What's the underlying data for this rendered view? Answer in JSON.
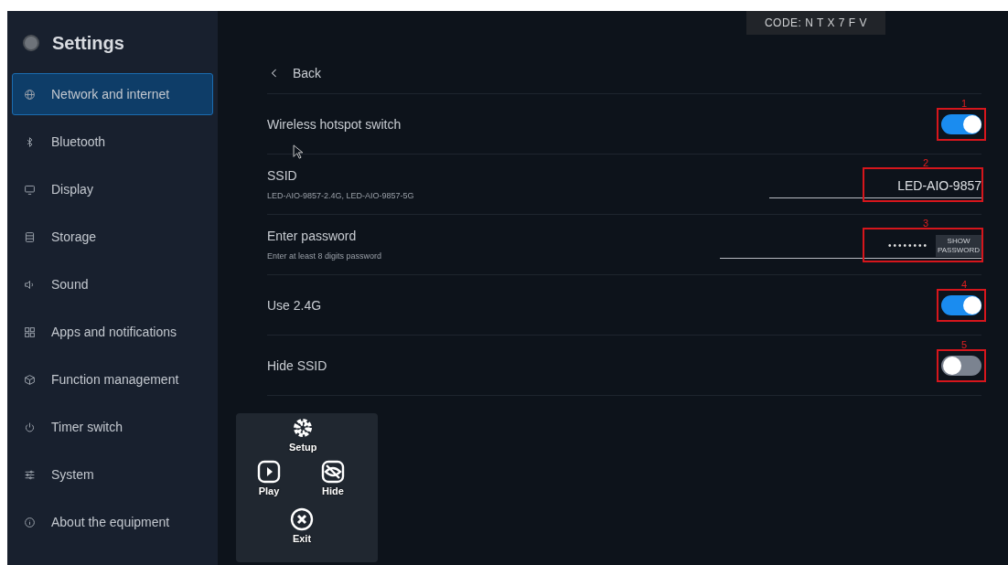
{
  "code_badge": {
    "text": "CODE:  N T X 7 F V"
  },
  "sidebar": {
    "title": "Settings",
    "items": [
      {
        "label": "Network and internet",
        "selected": true
      },
      {
        "label": "Bluetooth",
        "selected": false
      },
      {
        "label": "Display",
        "selected": false
      },
      {
        "label": "Storage",
        "selected": false
      },
      {
        "label": "Sound",
        "selected": false
      },
      {
        "label": "Apps and notifications",
        "selected": false
      },
      {
        "label": "Function management",
        "selected": false
      },
      {
        "label": "Timer switch",
        "selected": false
      },
      {
        "label": "System",
        "selected": false
      },
      {
        "label": "About the equipment",
        "selected": false
      }
    ]
  },
  "floating_menu": {
    "items": [
      {
        "label": "Setup"
      },
      {
        "label": "Play"
      },
      {
        "label": "Hide"
      },
      {
        "label": "Exit"
      }
    ]
  },
  "back": {
    "label": "Back"
  },
  "rows": [
    {
      "kind": "switch",
      "label": "Wireless hotspot switch",
      "on": true,
      "annotation": "1"
    },
    {
      "kind": "text",
      "label": "SSID",
      "hint": "LED-AIO-9857-2.4G, LED-AIO-9857-5G",
      "value": "LED-AIO-9857",
      "annotation": "2"
    },
    {
      "kind": "password",
      "label": "Enter password",
      "hint": "Enter at least 8 digits password",
      "value": "••••••••",
      "button": "SHOW PASSWORD",
      "annotation": "3"
    },
    {
      "kind": "switch",
      "label": "Use 2.4G",
      "on": true,
      "annotation": "4"
    },
    {
      "kind": "switch",
      "label": "Hide SSID",
      "on": false,
      "annotation": "5"
    }
  ]
}
